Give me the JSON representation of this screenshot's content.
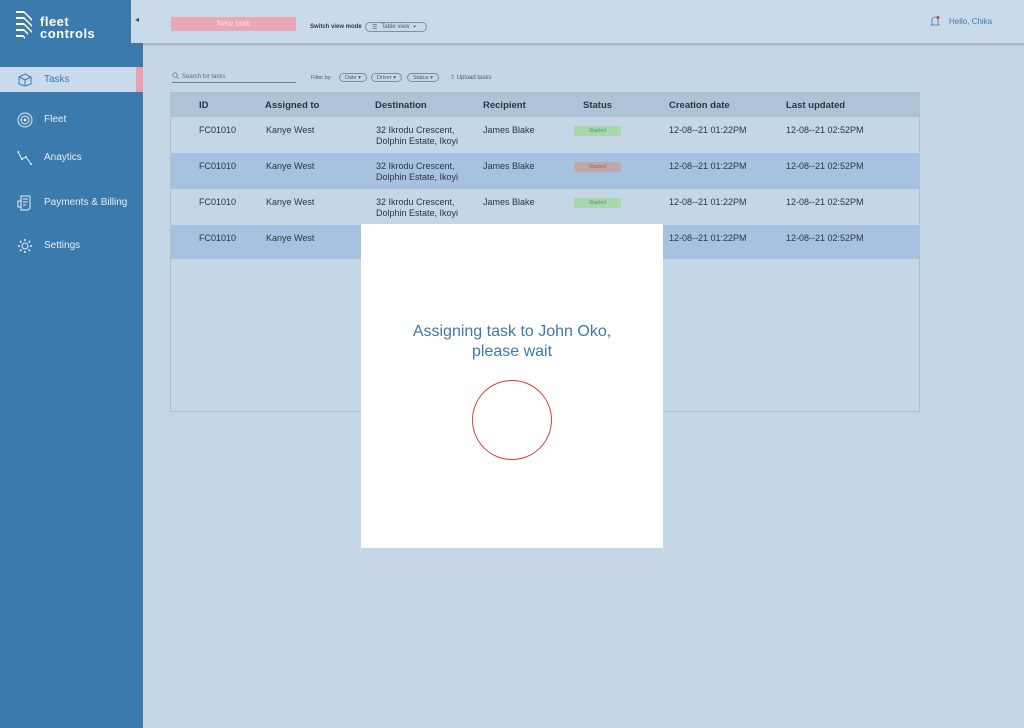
{
  "brand": {
    "line1": "fleet",
    "line2": "controls"
  },
  "sidebar": {
    "items": [
      {
        "label": "Tasks",
        "icon": "box-icon"
      },
      {
        "label": "Fleet",
        "icon": "wheel-icon"
      },
      {
        "label": "Anaytics",
        "icon": "graph-icon"
      },
      {
        "label": "Payments & Billing",
        "icon": "receipt-icon"
      },
      {
        "label": "Settings",
        "icon": "gear-icon"
      }
    ],
    "collapse_glyph": "◂"
  },
  "header": {
    "new_task_label": "New task",
    "view_mode_label": "Switch view mode",
    "view_select_value": "Table view",
    "greeting": "Hello, Chika"
  },
  "toolbar": {
    "search_placeholder": "Search for tasks",
    "filter_label": "Filter by:",
    "filters": [
      "Date",
      "Driver",
      "Status"
    ],
    "upload_label": "Upload tasks"
  },
  "table": {
    "columns": [
      "ID",
      "Assigned to",
      "Destination",
      "Recipient",
      "Status",
      "Creation date",
      "Last updated"
    ],
    "rows": [
      {
        "id": "FC01010",
        "assigned": "Kanye West",
        "dest1": "32 Ikrodu Crescent,",
        "dest2": "Dolphin Estate, Ikoyi",
        "recipient": "James Blake",
        "status": "Started",
        "created": "12-08--21 01:22PM",
        "updated": "12-08--21 02:52PM"
      },
      {
        "id": "FC01010",
        "assigned": "Kanye West",
        "dest1": "32 Ikrodu Crescent,",
        "dest2": "Dolphin Estate, Ikoyi",
        "recipient": "James Blake",
        "status": "Started",
        "created": "12-08--21 01:22PM",
        "updated": "12-08--21 02:52PM"
      },
      {
        "id": "FC01010",
        "assigned": "Kanye West",
        "dest1": "32 Ikrodu Crescent,",
        "dest2": "Dolphin Estate, Ikoyi",
        "recipient": "James Blake",
        "status": "Started",
        "created": "12-08--21 01:22PM",
        "updated": "12-08--21 02:52PM"
      },
      {
        "id": "FC01010",
        "assigned": "Kanye West",
        "created": "12-08--21 01:22PM",
        "updated": "12-08--21 02:52PM"
      }
    ]
  },
  "modal": {
    "line1": "Assigning task to John Oko,",
    "line2": "please wait"
  },
  "colors": {
    "sidebar": "#3b7aad",
    "accent_pink": "#e9a8b5",
    "status_green": "#a8d7ad",
    "spinner_red": "#e23a3a"
  }
}
